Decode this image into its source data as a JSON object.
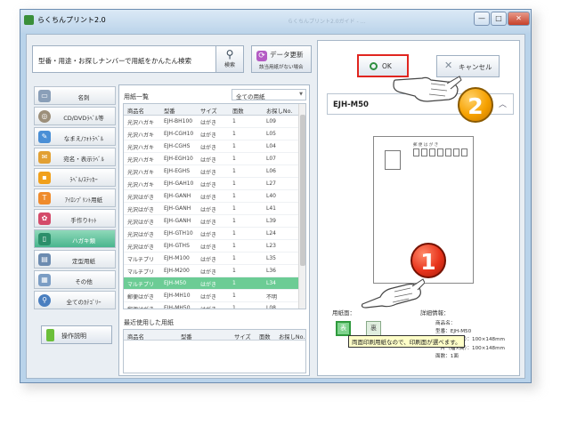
{
  "window": {
    "title": "らくちんプリント2.0",
    "blurred_title": "らくちんプリント2.0ガイド - ...",
    "buttons": {
      "minimize": "—",
      "maximize": "□",
      "close": "✕"
    }
  },
  "search": {
    "value": "型番・用途・お探しナンバーで用紙をかんたん検索",
    "button_label": "検索",
    "update_line1": "データ更新",
    "update_line2": "該当用紙がない場合"
  },
  "sidebar": {
    "items": [
      {
        "label": "名刺",
        "icon": "business-card-icon",
        "color": "#8a9fb8"
      },
      {
        "label": "CD/DVDﾗﾍﾞﾙ等",
        "icon": "cd-icon",
        "color": "#9c8f7a"
      },
      {
        "label": "なまえ/ﾌｫﾄﾗﾍﾞﾙ",
        "icon": "name-label-icon",
        "color": "#4a8fd6"
      },
      {
        "label": "宛名・表示ﾗﾍﾞﾙ",
        "icon": "address-label-icon",
        "color": "#e2a033"
      },
      {
        "label": "ﾗﾍﾞﾙ/ｽﾃｯｶｰ",
        "icon": "sticker-icon",
        "color": "#f1a01b"
      },
      {
        "label": "ｱｲﾛﾝﾌﾟﾘﾝﾄ用紙",
        "icon": "tshirt-icon",
        "color": "#ef8b2c"
      },
      {
        "label": "手作りｷｯﾄ",
        "icon": "handmade-kit-icon",
        "color": "#d44b6a"
      },
      {
        "label": "ハガキ類",
        "icon": "postcard-icon",
        "color": "#2b8f6a"
      },
      {
        "label": "定型用紙",
        "icon": "standard-paper-icon",
        "color": "#6c8bb0"
      },
      {
        "label": "その他",
        "icon": "other-icon",
        "color": "#7b9dc4"
      },
      {
        "label": "全てのｶﾃｺﾞﾘｰ",
        "icon": "magnifier-icon",
        "color": "#4a7fc0"
      }
    ],
    "active_index": 7,
    "help_label": "操作説明"
  },
  "paper_list": {
    "title": "用紙一覧",
    "filter_value": "全ての用紙",
    "columns": [
      "商品名",
      "型番",
      "サイズ",
      "面数",
      "お探しNo."
    ],
    "rows": [
      [
        "光沢ハガキ",
        "EJH-BH100",
        "はがき",
        "1",
        "L09"
      ],
      [
        "光沢ハガキ",
        "EJH-CGH10",
        "はがき",
        "1",
        "L05"
      ],
      [
        "光沢ハガキ",
        "EJH-CGHS",
        "はがき",
        "1",
        "L04"
      ],
      [
        "光沢ハガキ",
        "EJH-EGH10",
        "はがき",
        "1",
        "L07"
      ],
      [
        "光沢ハガキ",
        "EJH-EGHS",
        "はがき",
        "1",
        "L06"
      ],
      [
        "光沢ハガキ",
        "EJH-GAH10",
        "はがき",
        "1",
        "L27"
      ],
      [
        "光沢はがき",
        "EJH-GANH",
        "はがき",
        "1",
        "L40"
      ],
      [
        "光沢はがき",
        "EJH-GANH",
        "はがき",
        "1",
        "L41"
      ],
      [
        "光沢はがき",
        "EJH-GANH",
        "はがき",
        "1",
        "L39"
      ],
      [
        "光沢はがき",
        "EJH-GTH10",
        "はがき",
        "1",
        "L24"
      ],
      [
        "光沢はがき",
        "EJH-GTHS",
        "はがき",
        "1",
        "L23"
      ],
      [
        "マルチプリ",
        "EJH-M100",
        "はがき",
        "1",
        "L35"
      ],
      [
        "マルチプリ",
        "EJH-M200",
        "はがき",
        "1",
        "L36"
      ],
      [
        "マルチプリ",
        "EJH-M50",
        "はがき",
        "1",
        "L34"
      ],
      [
        "郵便はがき",
        "EJH-MH10",
        "はがき",
        "1",
        "不明"
      ],
      [
        "郵便はがき",
        "EJH-MH50",
        "はがき",
        "1",
        "L08"
      ]
    ],
    "selected_index": 13,
    "recent_title": "最近使用した用紙",
    "recent_columns": [
      "商品名",
      "型番",
      "サイズ",
      "面数",
      "お探しNo."
    ]
  },
  "right_panel": {
    "ok_label": "OK",
    "cancel_label": "キャンセル",
    "selected_model": "EJH-M50",
    "postcard_label": "郵 便 は が き",
    "paper_face_label": "用紙面：",
    "face_front": "表",
    "face_back": "裏",
    "detail_label": "詳細情報：",
    "details": {
      "name": "商品名：",
      "model": "型番：EJH-M50",
      "size": "用紙（幅×高）：100×148mm",
      "cut": "一片（幅×高）：100×148mm",
      "faces": "面数：1面"
    },
    "tooltip": "両面印刷用紙なので、印刷面が選べます。"
  },
  "annotations": {
    "step1": "1",
    "step2": "2"
  }
}
